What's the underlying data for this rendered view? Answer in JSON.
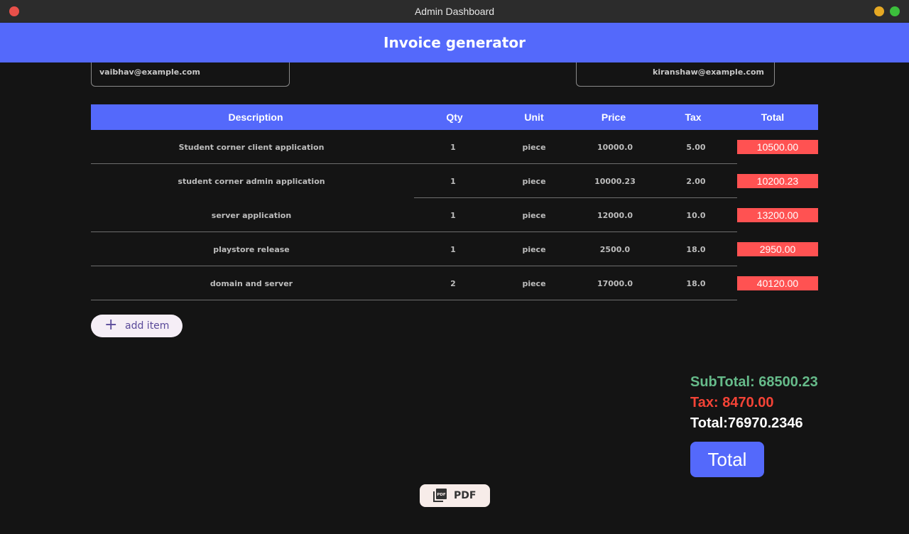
{
  "window": {
    "title": "Admin Dashboard"
  },
  "appbar": {
    "title": "Invoice generator"
  },
  "from_email": "vaibhav@example.com",
  "to_email": "kiranshaw@example.com",
  "table": {
    "headers": {
      "description": "Description",
      "qty": "Qty",
      "unit": "Unit",
      "price": "Price",
      "tax": "Tax",
      "total": "Total"
    },
    "rows": [
      {
        "description": "Student corner client  application",
        "qty": "1",
        "unit": "piece",
        "price": "10000.0",
        "tax": "5.00",
        "total": "10500.00"
      },
      {
        "description": "student corner admin application",
        "qty": "1",
        "unit": "piece",
        "price": "10000.23",
        "tax": "2.00",
        "total": "10200.23"
      },
      {
        "description": "server application",
        "qty": "1",
        "unit": "piece",
        "price": "12000.0",
        "tax": "10.0",
        "total": "13200.00"
      },
      {
        "description": "playstore release",
        "qty": "1",
        "unit": "piece",
        "price": "2500.0",
        "tax": "18.0",
        "total": "2950.00"
      },
      {
        "description": "domain and server",
        "qty": "2",
        "unit": "piece",
        "price": "17000.0",
        "tax": "18.0",
        "total": "40120.00"
      }
    ]
  },
  "add_item": {
    "icon": "plus-icon",
    "label": "add item"
  },
  "summary": {
    "subtotal": "SubTotal: 68500.23",
    "tax": "Tax: 8470.00",
    "total": "Total:76970.2346"
  },
  "total_button": {
    "label": "Total"
  },
  "pdf_button": {
    "icon": "pdf-icon",
    "label": "PDF"
  },
  "colors": {
    "accent": "#5469fb",
    "total_cell": "#ff5252",
    "subtotal": "#66bb8a",
    "tax": "#f44336",
    "background": "#141414"
  }
}
